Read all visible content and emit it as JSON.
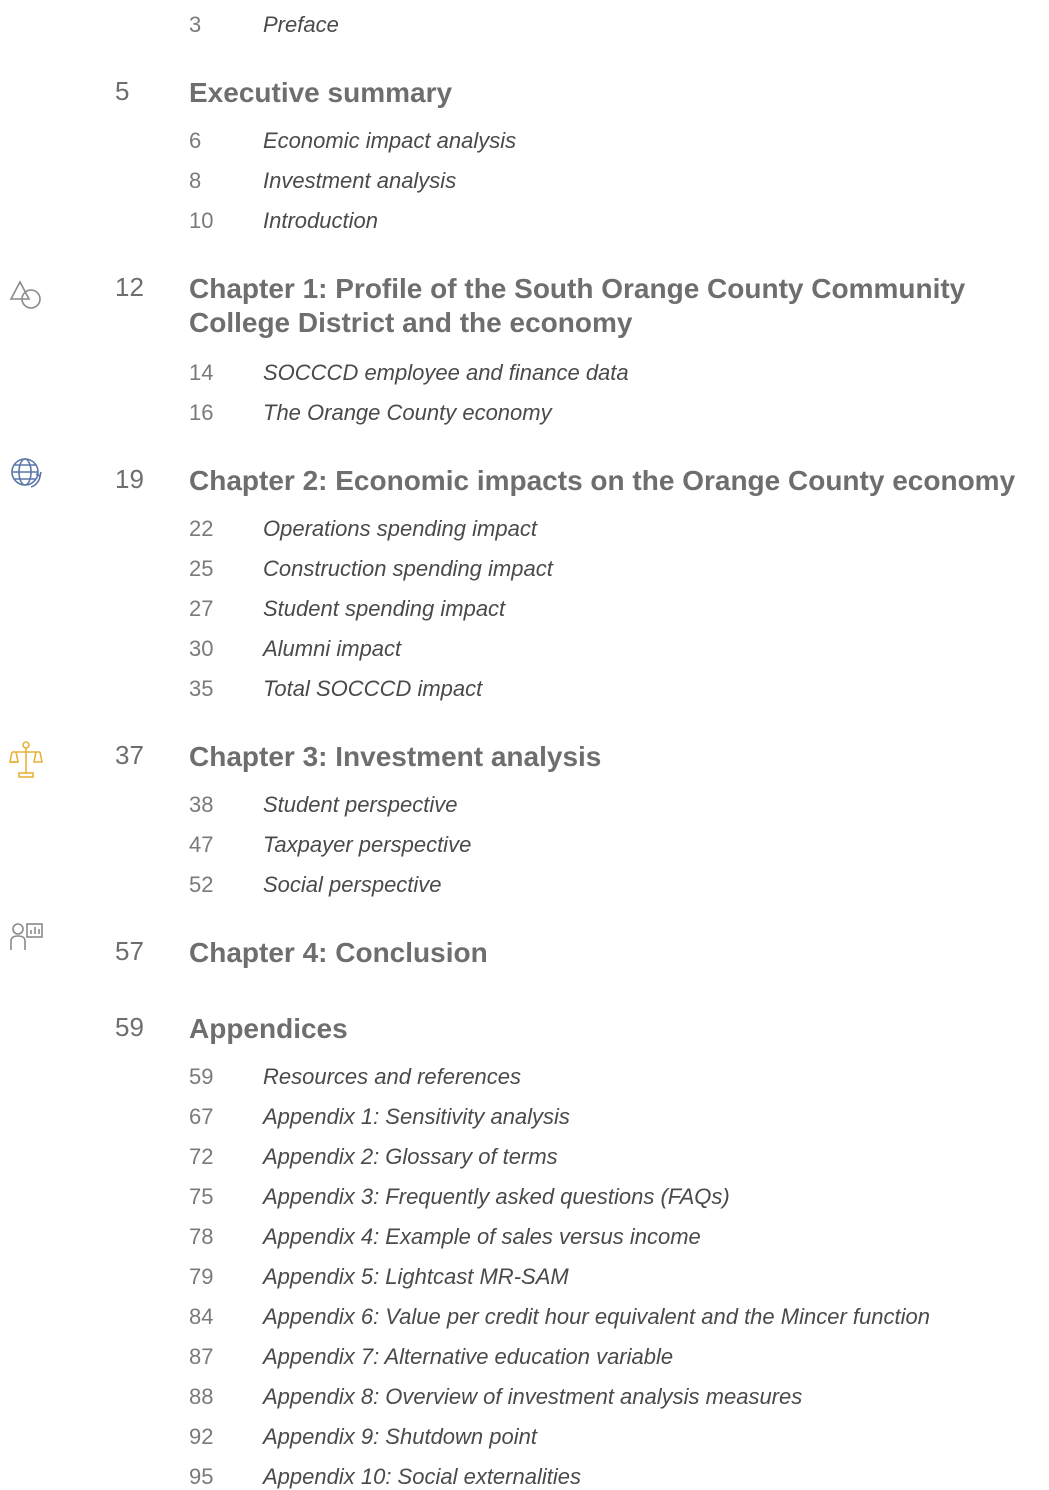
{
  "toc": [
    {
      "level": "sub",
      "page": "3",
      "title": "Preface"
    },
    {
      "level": "section",
      "page": "5",
      "title": "Executive summary"
    },
    {
      "level": "sub",
      "page": "6",
      "title": "Economic impact analysis"
    },
    {
      "level": "sub",
      "page": "8",
      "title": "Investment analysis"
    },
    {
      "level": "sub",
      "page": "10",
      "title": "Introduction"
    },
    {
      "level": "section",
      "page": "12",
      "title": "Chapter 1:  Profile of the South Orange County Community College District and the economy",
      "icon": "shapes-icon"
    },
    {
      "level": "sub",
      "page": "14",
      "title": "SOCCCD employee and finance data"
    },
    {
      "level": "sub",
      "page": "16",
      "title": "The Orange County economy"
    },
    {
      "level": "section",
      "page": "19",
      "title": "Chapter 2:  Economic impacts on the Orange County economy",
      "icon": "globe-icon"
    },
    {
      "level": "sub",
      "page": "22",
      "title": "Operations spending impact"
    },
    {
      "level": "sub",
      "page": "25",
      "title": "Construction spending impact"
    },
    {
      "level": "sub",
      "page": "27",
      "title": "Student spending impact"
    },
    {
      "level": "sub",
      "page": "30",
      "title": "Alumni impact"
    },
    {
      "level": "sub",
      "page": "35",
      "title": "Total SOCCCD impact"
    },
    {
      "level": "section",
      "page": "37",
      "title": "Chapter 3:  Investment analysis",
      "icon": "scales-icon"
    },
    {
      "level": "sub",
      "page": "38",
      "title": "Student perspective"
    },
    {
      "level": "sub",
      "page": "47",
      "title": "Taxpayer perspective"
    },
    {
      "level": "sub",
      "page": "52",
      "title": "Social perspective"
    },
    {
      "level": "section",
      "page": "57",
      "title": "Chapter 4:  Conclusion",
      "icon": "person-chart-icon"
    },
    {
      "level": "section",
      "page": "59",
      "title": "Appendices"
    },
    {
      "level": "sub",
      "page": "59",
      "title": "Resources and references"
    },
    {
      "level": "sub",
      "page": "67",
      "title": "Appendix 1:  Sensitivity analysis"
    },
    {
      "level": "sub",
      "page": "72",
      "title": "Appendix 2:  Glossary of terms"
    },
    {
      "level": "sub",
      "page": "75",
      "title": "Appendix 3:  Frequently asked questions (FAQs)"
    },
    {
      "level": "sub",
      "page": "78",
      "title": "Appendix 4:  Example of sales versus income"
    },
    {
      "level": "sub",
      "page": "79",
      "title": "Appendix 5:  Lightcast MR-SAM"
    },
    {
      "level": "sub",
      "page": "84",
      "title": "Appendix 6:  Value per credit hour equivalent and the Mincer function"
    },
    {
      "level": "sub",
      "page": "87",
      "title": "Appendix 7:  Alternative education variable"
    },
    {
      "level": "sub",
      "page": "88",
      "title": "Appendix 8:  Overview of investment analysis measures"
    },
    {
      "level": "sub",
      "page": "92",
      "title": "Appendix 9:  Shutdown point"
    },
    {
      "level": "sub",
      "page": "95",
      "title": "Appendix 10:  Social externalities"
    }
  ],
  "colors": {
    "gray_icon": "#8a8a8a",
    "blue_icon": "#5a77a8",
    "gold_icon": "#e8b23a"
  }
}
